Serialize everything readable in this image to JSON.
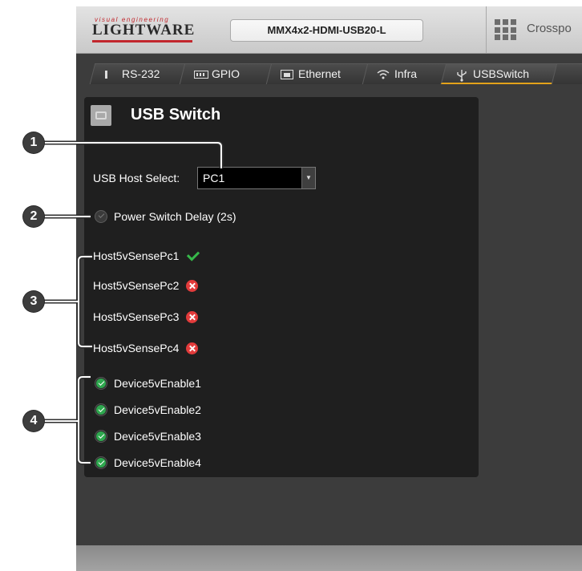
{
  "header": {
    "logo_small": "visual engineering",
    "logo_main": "LIGHTWARE",
    "device_name": "MMX4x2-HDMI-USB20-L",
    "crosspoint_label": "Crosspo"
  },
  "tabs": [
    {
      "label": "RS-232",
      "icon": "serial-port-icon"
    },
    {
      "label": "GPIO",
      "icon": "gpio-connector-icon"
    },
    {
      "label": "Ethernet",
      "icon": "ethernet-icon"
    },
    {
      "label": "Infra",
      "icon": "wifi-signal-icon"
    },
    {
      "label": "USBSwitch",
      "icon": "usb-icon",
      "active": true
    }
  ],
  "panel": {
    "title": "USB Switch",
    "host_select_label": "USB Host Select:",
    "host_select_value": "PC1",
    "power_switch_delay_label": "Power Switch Delay (2s)",
    "power_switch_delay_checked": false,
    "host_sense": [
      {
        "label": "Host5vSensePc1",
        "status": "ok"
      },
      {
        "label": "Host5vSensePc2",
        "status": "error"
      },
      {
        "label": "Host5vSensePc3",
        "status": "error"
      },
      {
        "label": "Host5vSensePc4",
        "status": "error"
      }
    ],
    "device_enable": [
      {
        "label": "Device5vEnable1",
        "checked": true
      },
      {
        "label": "Device5vEnable2",
        "checked": true
      },
      {
        "label": "Device5vEnable3",
        "checked": true
      },
      {
        "label": "Device5vEnable4",
        "checked": true
      }
    ]
  },
  "callouts": [
    "1",
    "2",
    "3",
    "4"
  ],
  "colors": {
    "accent": "#e3a21a",
    "ok": "#36b84a",
    "error": "#e23b3b",
    "brand": "#c2272d"
  }
}
